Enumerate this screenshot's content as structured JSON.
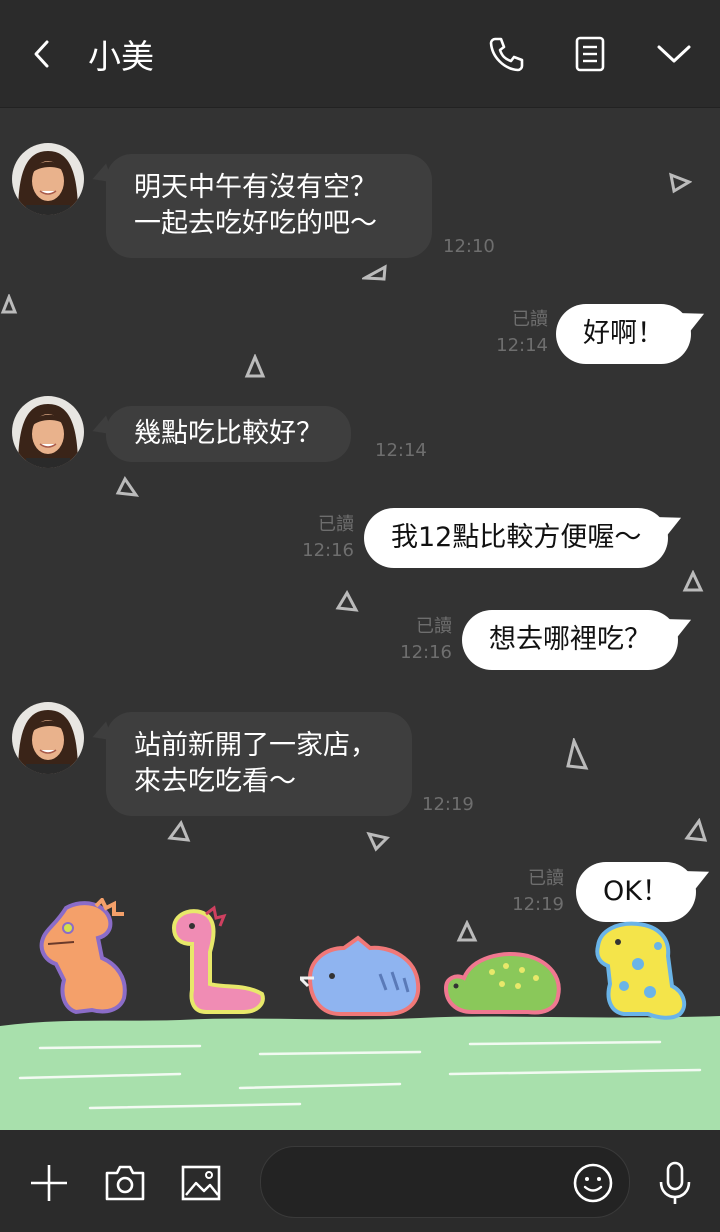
{
  "header": {
    "title": "小美",
    "back_icon": "chevron-left-icon",
    "call_icon": "phone-icon",
    "notes_icon": "document-icon",
    "menu_icon": "chevron-down-icon"
  },
  "messages": [
    {
      "direction": "in",
      "lines": [
        "明天中午有沒有空？",
        "一起去吃好吃的吧～"
      ],
      "time": "12:10"
    },
    {
      "direction": "out",
      "text": "好啊！",
      "read": "已讀",
      "time": "12:14"
    },
    {
      "direction": "in",
      "lines": [
        "幾點吃比較好？"
      ],
      "time": "12:14"
    },
    {
      "direction": "out",
      "text": "我12點比較方便喔～",
      "read": "已讀",
      "time": "12:16"
    },
    {
      "direction": "out",
      "text": "想去哪裡吃？",
      "read": "已讀",
      "time": "12:16"
    },
    {
      "direction": "in",
      "lines": [
        "站前新開了一家店，",
        "來去吃吃看～"
      ],
      "time": "12:19"
    },
    {
      "direction": "out",
      "text": "OK！",
      "read": "已讀",
      "time": "12:19"
    }
  ],
  "footer": {
    "add_icon": "plus-icon",
    "camera_icon": "camera-icon",
    "image_icon": "image-icon",
    "emoji_icon": "smiley-icon",
    "mic_icon": "microphone-icon",
    "input_value": ""
  },
  "colors": {
    "header_bg": "#2b2b2b",
    "chat_bg": "#333333",
    "incoming_bubble": "#3e3e3e",
    "outgoing_bubble": "#ffffff",
    "grass": "#a8e0ac"
  }
}
